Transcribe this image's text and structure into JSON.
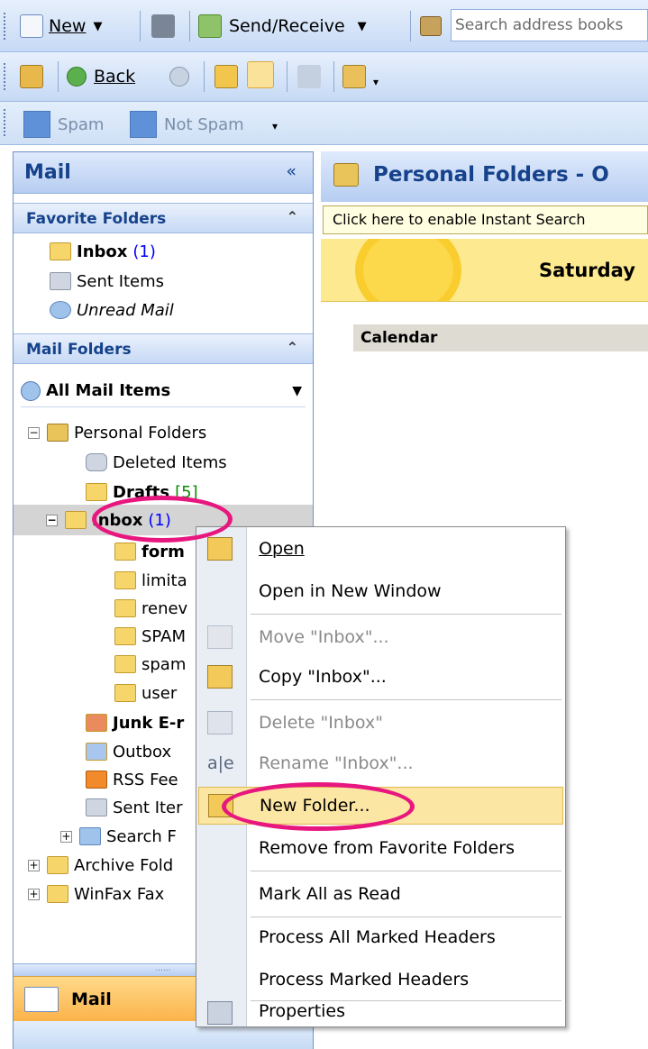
{
  "toolbar1": {
    "new_label": "New",
    "send_receive_label": "Send/Receive",
    "search_placeholder": "Search address books"
  },
  "toolbar2": {
    "back_label": "Back"
  },
  "toolbar3": {
    "spam_label": "Spam",
    "not_spam_label": "Not Spam"
  },
  "nav": {
    "title": "Mail",
    "collapse_glyph": "«",
    "favorites_header": "Favorite Folders",
    "favorites": [
      {
        "label": "Inbox",
        "count": "(1)",
        "icon": "inbox-icon"
      },
      {
        "label": "Sent Items",
        "icon": "sent-items-icon"
      },
      {
        "label": "Unread Mail",
        "icon": "search-folder-icon"
      }
    ],
    "mail_folders_header": "Mail Folders",
    "all_mail_items": "All Mail Items",
    "tree": {
      "personal_folders": "Personal Folders",
      "deleted_items": "Deleted Items",
      "drafts": "Drafts",
      "drafts_count": "[5]",
      "inbox": "Inbox",
      "inbox_count": "(1)",
      "inbox_subfolders": [
        "form",
        "limita",
        "renev",
        "SPAM",
        "spam",
        "user"
      ],
      "junk": "Junk E-r",
      "outbox": "Outbox",
      "rss": "RSS Fee",
      "sent": "Sent Iter",
      "search_folders": "Search F",
      "archive": "Archive Fold",
      "winfax": "WinFax Fax"
    },
    "bottom_mail": "Mail",
    "grip_dots": "......"
  },
  "main": {
    "title": "Personal Folders - O",
    "instant_search": "Click here to enable Instant Search",
    "date": "Saturday",
    "calendar_header": "Calendar"
  },
  "context_menu": {
    "items": [
      {
        "label": "Open",
        "icon": "open-folder-icon",
        "enabled": true
      },
      {
        "label": "Open in New Window",
        "enabled": true
      },
      {
        "label": "Move \"Inbox\"...",
        "icon": "move-icon",
        "enabled": false
      },
      {
        "label": "Copy \"Inbox\"...",
        "icon": "copy-icon",
        "enabled": true
      },
      {
        "label": "Delete \"Inbox\"",
        "icon": "delete-icon",
        "enabled": false
      },
      {
        "label": "Rename \"Inbox\"...",
        "icon": "rename-icon",
        "enabled": false
      },
      {
        "label": "New Folder...",
        "icon": "new-folder-icon",
        "enabled": true,
        "highlighted": true
      },
      {
        "label": "Remove from Favorite Folders",
        "enabled": true
      },
      {
        "label": "Mark All as Read",
        "enabled": true
      },
      {
        "label": "Process All Marked Headers",
        "enabled": true
      },
      {
        "label": "Process Marked Headers",
        "enabled": true
      },
      {
        "label": "Properties",
        "icon": "properties-icon",
        "enabled": true
      }
    ]
  },
  "colors": {
    "accent": "#15428b",
    "highlight_oval": "#e8177f",
    "menu_highlight": "#fce6a4",
    "date_band": "#fde98f"
  }
}
